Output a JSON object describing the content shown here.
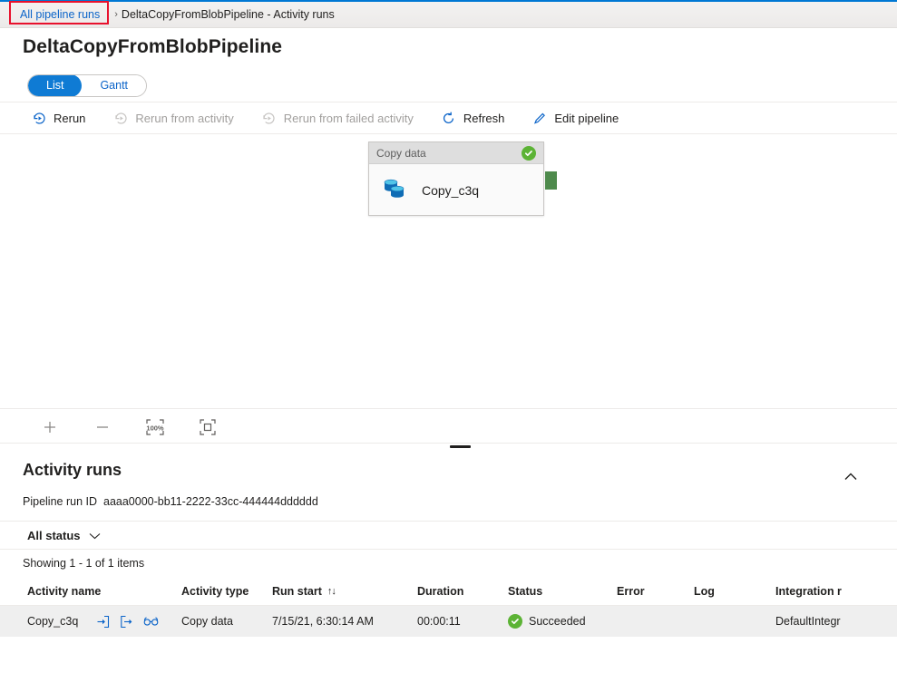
{
  "breadcrumb": {
    "link": "All pipeline runs",
    "separator": "›",
    "current": "DeltaCopyFromBlobPipeline - Activity runs",
    "highlight_color": "#e8112d"
  },
  "page": {
    "title": "DeltaCopyFromBlobPipeline",
    "accent_color": "#0078d4"
  },
  "view_toggle": {
    "options": [
      "List",
      "Gantt"
    ],
    "selected": "List"
  },
  "toolbar": {
    "items": [
      {
        "label": "Rerun",
        "icon": "rerun-icon",
        "enabled": true
      },
      {
        "label": "Rerun from activity",
        "icon": "rerun-from-activity-icon",
        "enabled": false
      },
      {
        "label": "Rerun from failed activity",
        "icon": "rerun-from-failed-activity-icon",
        "enabled": false
      },
      {
        "label": "Refresh",
        "icon": "refresh-icon",
        "enabled": true
      },
      {
        "label": "Edit pipeline",
        "icon": "pencil-icon",
        "enabled": true
      }
    ]
  },
  "canvas": {
    "activity_card": {
      "header": "Copy data",
      "name": "Copy_c3q",
      "status_icon": "success-check-icon",
      "status_color": "#5cb335",
      "connector_color": "#4e8a4c"
    }
  },
  "zoom_controls": {
    "items": [
      {
        "label": "+",
        "icon": "zoom-in-icon"
      },
      {
        "label": "–",
        "icon": "zoom-out-icon"
      },
      {
        "label": "100%",
        "icon": "zoom-reset-icon"
      },
      {
        "label": "",
        "icon": "zoom-to-fit-icon"
      }
    ]
  },
  "activity_runs": {
    "title": "Activity runs",
    "collapse_icon": "chevron-up-icon",
    "pipeline_run_id_label": "Pipeline run ID",
    "pipeline_run_id_value": "aaaa0000-bb11-2222-33cc-444444dddddd",
    "status_filter": {
      "label": "All status",
      "chevron": "chevron-down-icon"
    },
    "showing": "Showing 1 - 1 of 1 items",
    "columns": [
      "Activity name",
      "Activity type",
      "Run start",
      "Duration",
      "Status",
      "Error",
      "Log",
      "Integration r"
    ],
    "sort_column": "Run start",
    "sort_indicator": "↑↓",
    "rows": [
      {
        "activity_name": "Copy_c3q",
        "row_icons": [
          "input-icon",
          "output-icon",
          "details-glasses-icon"
        ],
        "activity_type": "Copy data",
        "run_start": "7/15/21, 6:30:14 AM",
        "duration": "00:00:11",
        "status": "Succeeded",
        "status_icon": "success-check-icon",
        "error": "",
        "log": "",
        "integration_runtime": "DefaultIntegr"
      }
    ]
  }
}
